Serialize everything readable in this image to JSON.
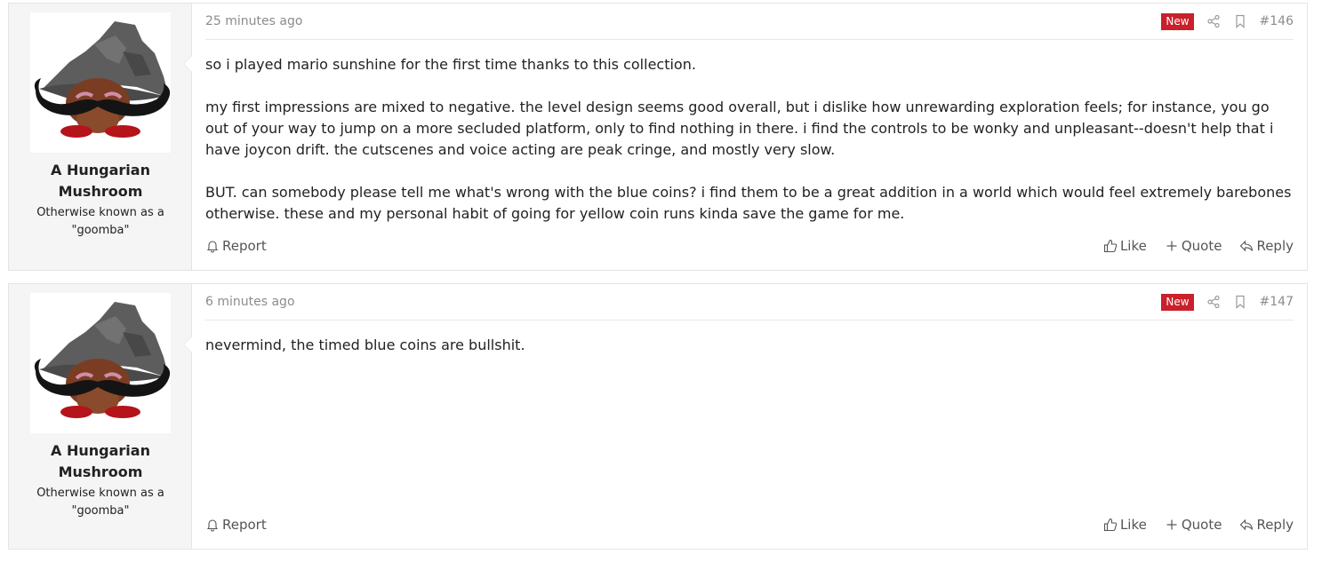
{
  "posts": [
    {
      "time": "25 minutes ago",
      "badge": "New",
      "number": "#146",
      "author": {
        "name": "A Hungarian Mushroom",
        "title": "Otherwise known as a \"goomba\""
      },
      "paragraphs": [
        "so i played mario sunshine for the first time thanks to this collection.",
        "my first impressions are mixed to negative. the level design seems good overall, but i dislike how unrewarding exploration feels; for instance, you go out of your way to jump on a more secluded platform, only to find nothing in there. i find the controls to be wonky and unpleasant--doesn't help that i have joycon drift. the cutscenes and voice acting are peak cringe, and mostly very slow.",
        "BUT. can somebody please tell me what's wrong with the blue coins? i find them to be a great addition in a world which would feel extremely barebones otherwise. these and my personal habit of going for yellow coin runs kinda save the game for me."
      ],
      "actions": {
        "report": "Report",
        "like": "Like",
        "quote": "Quote",
        "reply": "Reply"
      }
    },
    {
      "time": "6 minutes ago",
      "badge": "New",
      "number": "#147",
      "author": {
        "name": "A Hungarian Mushroom",
        "title": "Otherwise known as a \"goomba\""
      },
      "paragraphs": [
        "nevermind, the timed blue coins are bullshit."
      ],
      "actions": {
        "report": "Report",
        "like": "Like",
        "quote": "Quote",
        "reply": "Reply"
      }
    }
  ],
  "icons": {
    "share": "share-icon",
    "bookmark": "bookmark-icon",
    "report": "bell-icon",
    "like": "thumbs-up-icon",
    "quote": "plus-icon",
    "reply": "reply-icon"
  },
  "colors": {
    "badge": "#c9202b",
    "user_cell_bg": "#f5f5f5",
    "border": "#e4e4e4"
  }
}
